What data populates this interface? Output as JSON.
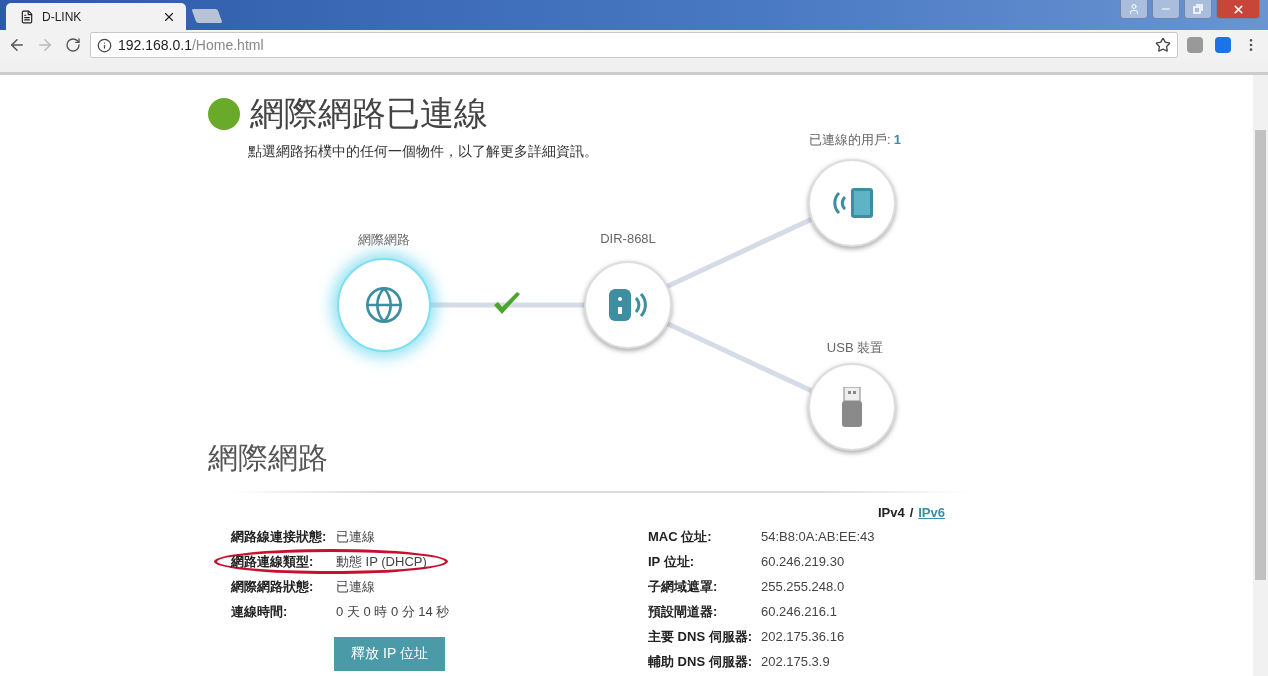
{
  "browser": {
    "tabs": [
      {
        "title": "D-LINK",
        "selected": true
      }
    ],
    "url_host": "192.168.0.1",
    "url_path": "/Home.html"
  },
  "status": {
    "title": "網際網路已連線",
    "connected": true,
    "hint": "點選網路拓樸中的任何一個物件，以了解更多詳細資訊。"
  },
  "topology": {
    "link_ok": true,
    "nodes": [
      {
        "kind": "internet",
        "label": "網際網路",
        "selected": true
      },
      {
        "kind": "router",
        "label": "DIR-868L",
        "selected": false
      },
      {
        "kind": "clients",
        "label": "已連線的用戶:",
        "count": "1",
        "selected": false
      },
      {
        "kind": "usb",
        "label": "USB 裝置",
        "selected": false
      }
    ]
  },
  "internet": {
    "title": "網際網路",
    "ip_versions": [
      {
        "label": "IPv4",
        "selected": true
      },
      {
        "label": "IPv6",
        "selected": false
      }
    ],
    "version_separator": "/",
    "left": [
      {
        "label": "網路線連接狀態:",
        "value": "已連線",
        "highlighted": false
      },
      {
        "label": "網路連線類型:",
        "value": "動態 IP (DHCP)",
        "highlighted": true
      },
      {
        "label": "網際網路狀態:",
        "value": "已連線",
        "highlighted": false
      },
      {
        "label": "連線時間:",
        "value": "0 天 0 時 0 分 14 秒",
        "highlighted": false
      }
    ],
    "button": "釋放 IP 位址",
    "right": [
      {
        "label": "MAC 位址:",
        "value": "54:B8:0A:AB:EE:43"
      },
      {
        "label": "IP 位址:",
        "value": "60.246.219.30"
      },
      {
        "label": "子網域遮罩:",
        "value": "255.255.248.0"
      },
      {
        "label": "預設閘道器:",
        "value": "60.246.216.1"
      },
      {
        "label": "主要 DNS 伺服器:",
        "value": "202.175.36.16"
      },
      {
        "label": "輔助 DNS 伺服器:",
        "value": "202.175.3.9"
      }
    ]
  }
}
